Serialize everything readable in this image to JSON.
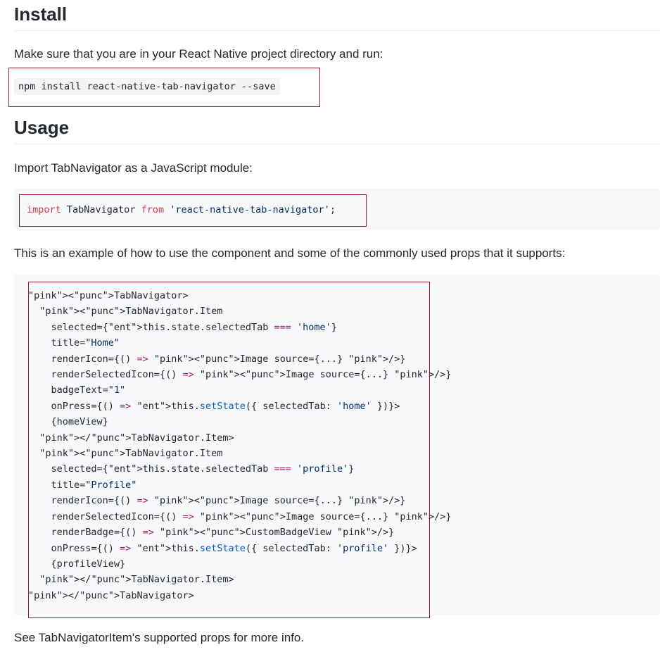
{
  "install": {
    "heading": "Install",
    "text": "Make sure that you are in your React Native project directory and run:",
    "command": "npm install react-native-tab-navigator --save"
  },
  "usage": {
    "heading": "Usage",
    "import_text": "Import TabNavigator as a JavaScript module:",
    "import_code": {
      "kw_import": "import",
      "name": " TabNavigator ",
      "kw_from": "from",
      "sp": " ",
      "module": "'react-native-tab-navigator'",
      "semi": ";"
    },
    "example_text": "This is an example of how to use the component and some of the commonly used props that it supports:",
    "example_lines": [
      "<TabNavigator>",
      "  <TabNavigator.Item",
      "    selected={this.state.selectedTab === 'home'}",
      "    title=\"Home\"",
      "    renderIcon={() => <Image source={...} />}",
      "    renderSelectedIcon={() => <Image source={...} />}",
      "    badgeText=\"1\"",
      "    onPress={() => this.setState({ selectedTab: 'home' })}>",
      "    {homeView}",
      "  </TabNavigator.Item>",
      "  <TabNavigator.Item",
      "    selected={this.state.selectedTab === 'profile'}",
      "    title=\"Profile\"",
      "    renderIcon={() => <Image source={...} />}",
      "    renderSelectedIcon={() => <Image source={...} />}",
      "    renderBadge={() => <CustomBadgeView />}",
      "    onPress={() => this.setState({ selectedTab: 'profile' })}>",
      "    {profileView}",
      "  </TabNavigator.Item>",
      "</TabNavigator>"
    ],
    "footer_text": "See TabNavigatorItem's supported props for more info."
  },
  "colors": {
    "highlight_border": "#9b1c2a",
    "code_background": "#f6f8fa",
    "heading_rule": "#eaecef"
  }
}
